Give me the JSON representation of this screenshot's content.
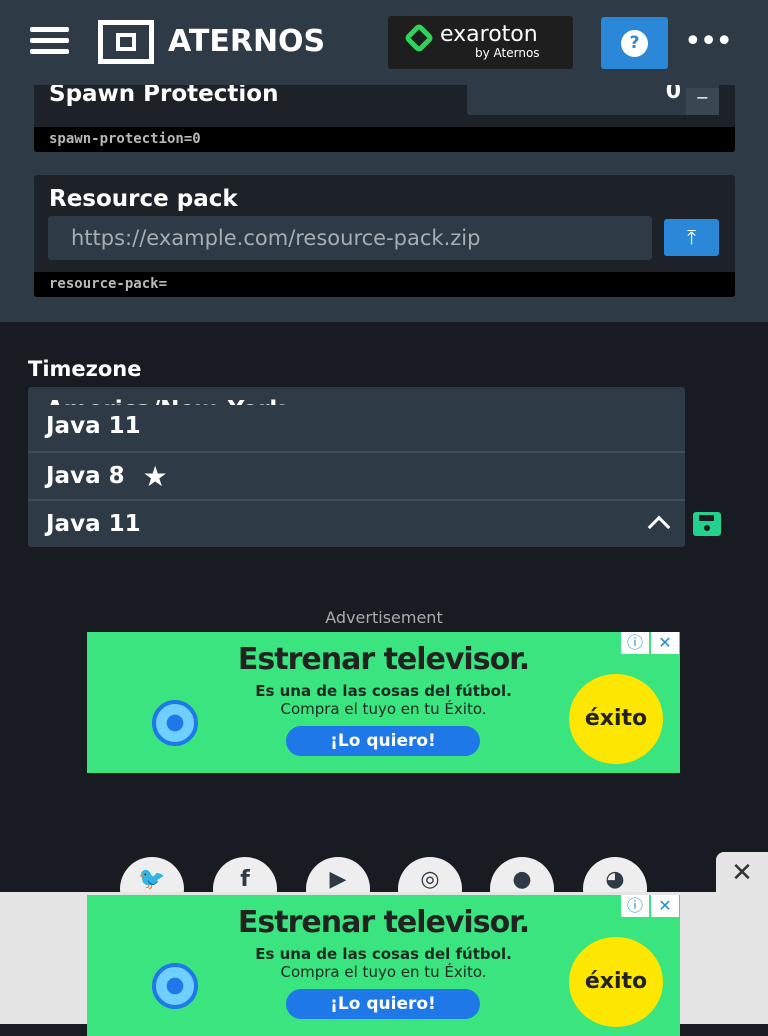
{
  "header": {
    "brand": "ATERNOS",
    "exaroton": "exaroton",
    "exaroton_sub": "by Aternos",
    "help": "?",
    "more": "•••"
  },
  "spawn": {
    "label": "Spawn Protection",
    "value": "0",
    "minus": "−",
    "code": "spawn-protection=0"
  },
  "resource": {
    "label": "Resource pack",
    "placeholder": "https://example.com/resource-pack.zip",
    "code": "resource-pack="
  },
  "timezone": {
    "label": "Timezone",
    "value": "America/New_York"
  },
  "java": {
    "options": [
      "Java 11",
      "Java 8"
    ],
    "selected": "Java 11"
  },
  "ad": {
    "label": "Advertisement",
    "headline": "Estrenar televisor.",
    "line1": "Es una de las cosas del fútbol.",
    "line2": "Compra el tuyo en tu Éxito.",
    "cta": "¡Lo quiero!",
    "brand": "éxito"
  },
  "social": [
    "twitter",
    "facebook",
    "youtube",
    "instagram",
    "reddit",
    "discord"
  ],
  "colors": {
    "accent": "#2b87d8",
    "save": "#22d18b",
    "ad_bg": "#3ae57f"
  }
}
